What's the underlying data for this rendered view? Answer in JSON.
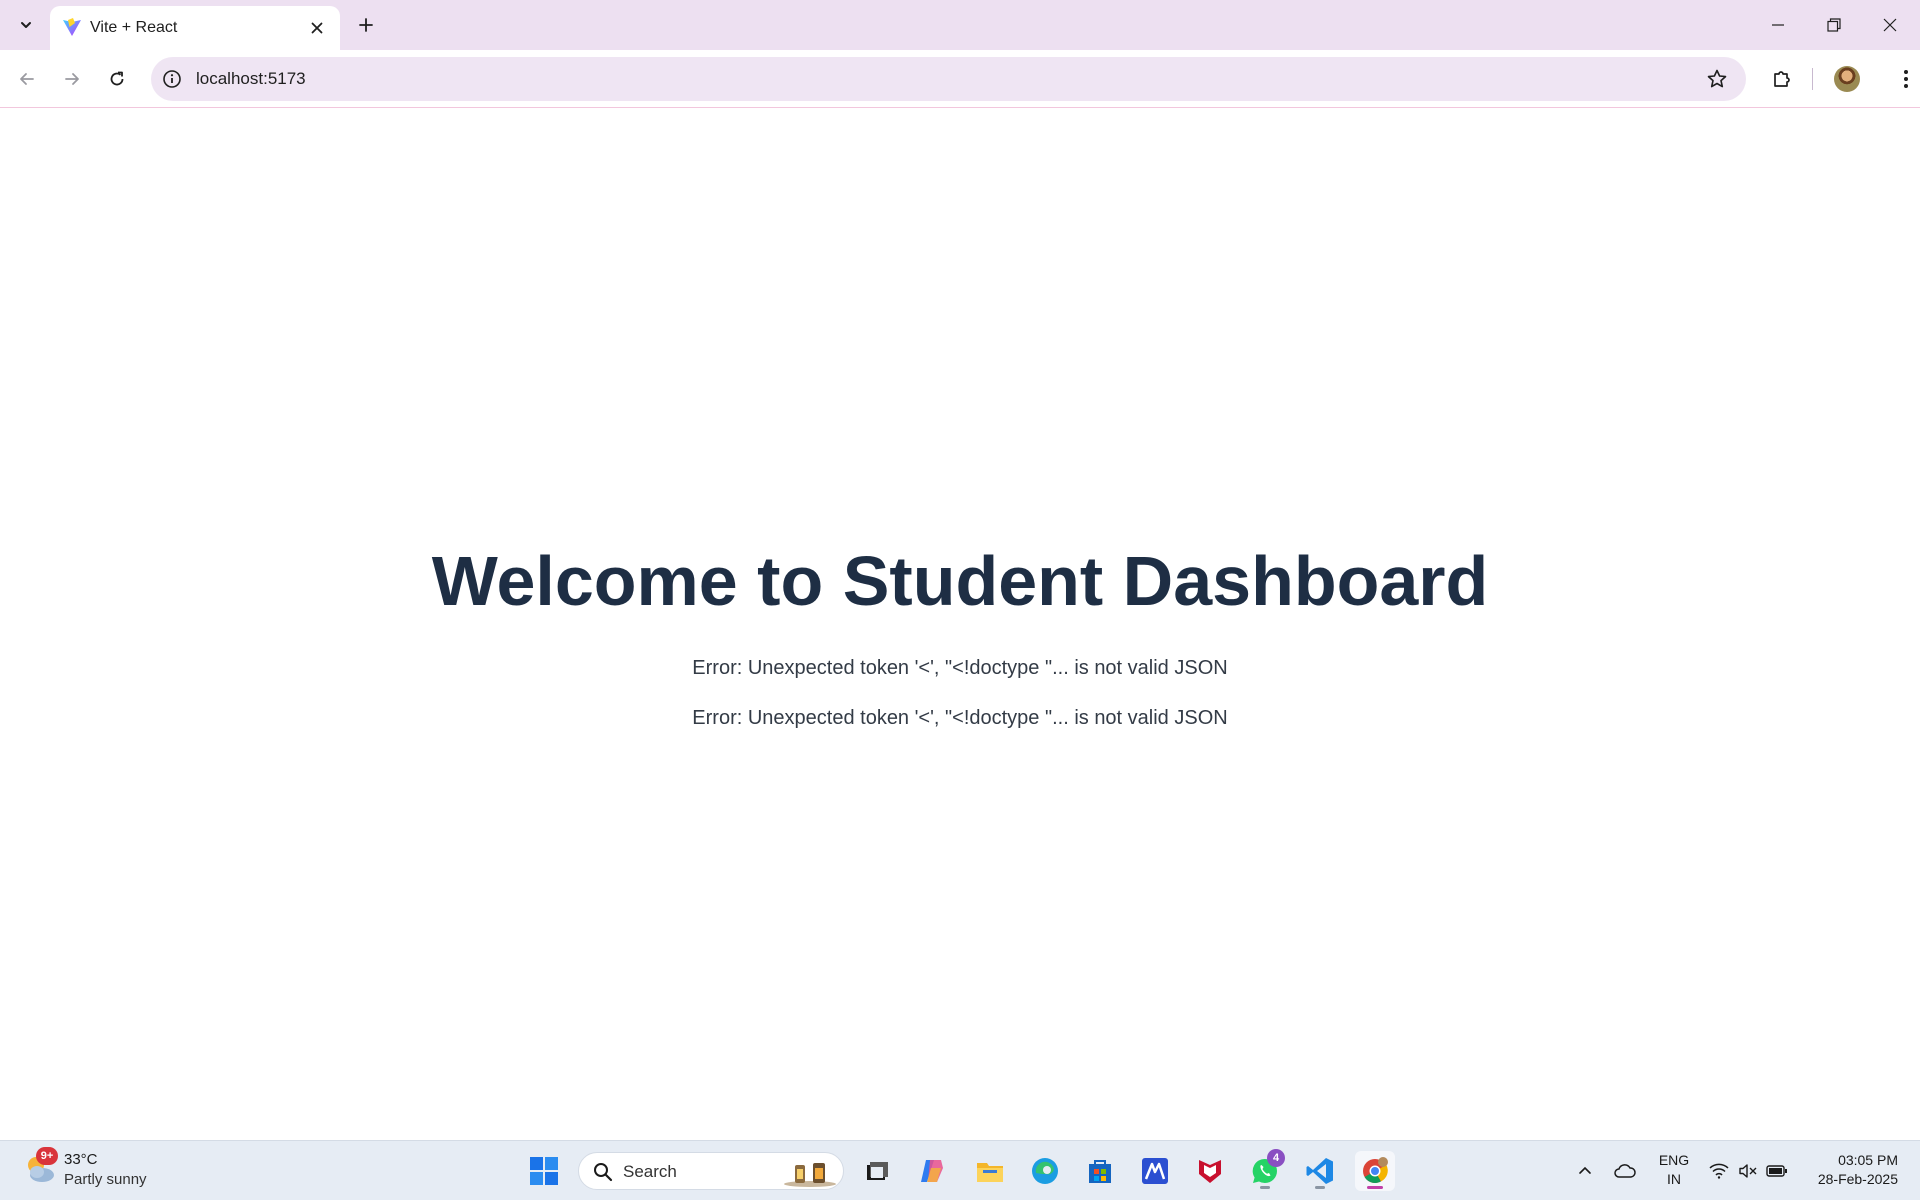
{
  "browser": {
    "tab": {
      "title": "Vite + React"
    },
    "omnibox": {
      "url": "localhost:5173"
    }
  },
  "page": {
    "title": "Welcome to Student Dashboard",
    "errors": [
      "Error: Unexpected token '<', \"<!doctype \"... is not valid JSON",
      "Error: Unexpected token '<', \"<!doctype \"... is not valid JSON"
    ]
  },
  "taskbar": {
    "weather": {
      "badge": "9+",
      "temperature": "33°C",
      "condition": "Partly sunny"
    },
    "search_label": "Search",
    "apps": [
      {
        "name": "start-icon"
      },
      {
        "name": "task-view-icon"
      },
      {
        "name": "copilot-icon"
      },
      {
        "name": "file-explorer-icon"
      },
      {
        "name": "edge-icon"
      },
      {
        "name": "microsoft-store-icon"
      },
      {
        "name": "app-m-icon"
      },
      {
        "name": "mcafee-icon"
      },
      {
        "name": "whatsapp-icon",
        "badge": "4"
      },
      {
        "name": "vscode-icon"
      },
      {
        "name": "chrome-icon"
      }
    ],
    "tray": {
      "language_line1": "ENG",
      "language_line2": "IN",
      "time": "03:05 PM",
      "date": "28-Feb-2025"
    }
  },
  "colors": {
    "tabstrip": "#ede0f1",
    "omnibox": "#efe5f3",
    "title": "#1e2e44",
    "error_text": "#333b46",
    "taskbar": "#e6ecf4"
  }
}
